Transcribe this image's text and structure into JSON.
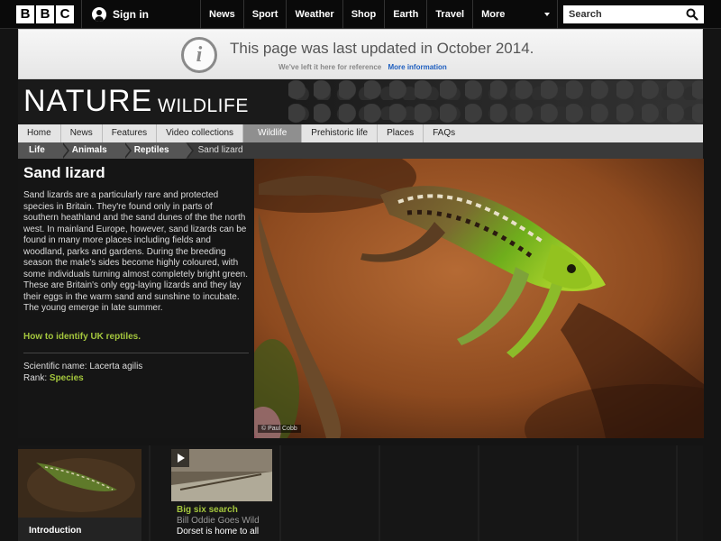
{
  "topbar": {
    "logo": [
      "B",
      "B",
      "C"
    ],
    "sign_in": "Sign in",
    "nav": [
      "News",
      "Sport",
      "Weather",
      "Shop",
      "Earth",
      "Travel"
    ],
    "more": "More",
    "search_placeholder": "Search"
  },
  "notice": {
    "title": "This page was last updated in October 2014.",
    "subtitle": "We've left it here for reference",
    "link": "More information"
  },
  "banner": {
    "title": "NATURE",
    "subtitle": "WILDLIFE"
  },
  "section_nav": {
    "tabs": [
      "Home",
      "News",
      "Features",
      "Video collections",
      "Wildlife",
      "Prehistoric life",
      "Places",
      "FAQs"
    ],
    "active": "Wildlife"
  },
  "breadcrumb": [
    "Life",
    "Animals",
    "Reptiles",
    "Sand lizard"
  ],
  "species": {
    "title": "Sand lizard",
    "description": "Sand lizards are a particularly rare and protected species in Britain. They're found only in parts of southern heathland and the sand dunes of the the north west. In mainland Europe, however, sand lizards can be found in many more places including fields and woodland, parks and gardens. During the breeding season the male's sides become highly coloured, with some individuals turning almost completely bright green. These are Britain's only egg-laying lizards and they lay their eggs in the warm sand and sunshine to incubate. The young emerge in late summer.",
    "identify_link": "How to identify UK reptiles.",
    "scientific_label": "Scientific name:",
    "scientific_name": "Lacerta agilis",
    "rank_label": "Rank:",
    "rank": "Species"
  },
  "photo": {
    "credit": "© Paul Cobb"
  },
  "bottom": {
    "intro_label": "Introduction",
    "video": {
      "title": "Big six search",
      "subtitle": "Bill Oddie Goes Wild",
      "description": "Dorset is home to all"
    }
  },
  "colors": {
    "accent_green": "#a4c63d",
    "link_blue": "#1f5fbf",
    "background": "#141414"
  }
}
